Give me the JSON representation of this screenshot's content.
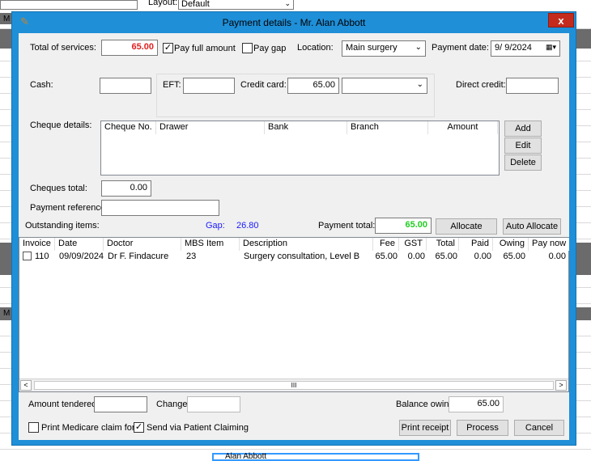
{
  "background": {
    "layout_label": "Layout:",
    "layout_value": "Default",
    "left_letter_top": "M",
    "left_letter_mid": "M",
    "patient_bottom": "Alan Abbott"
  },
  "dialog": {
    "title": "Payment details - Mr. Alan Abbott",
    "close_label": "x"
  },
  "top": {
    "total_services_label": "Total of services:",
    "total_services_value": "65.00",
    "pay_full_label": "Pay full amount",
    "pay_full_checked": true,
    "pay_gap_label": "Pay gap",
    "location_label": "Location:",
    "location_value": "Main surgery",
    "payment_date_label": "Payment date:",
    "payment_date_value": "9/ 9/2024",
    "cash_label": "Cash:",
    "eft_label": "EFT:",
    "credit_card_label": "Credit card:",
    "credit_card_value": "65.00",
    "direct_credit_label": "Direct credit:"
  },
  "cheques": {
    "label": "Cheque details:",
    "columns": [
      "Cheque No.",
      "Drawer",
      "Bank",
      "Branch",
      "Amount"
    ],
    "add_label": "Add",
    "edit_label": "Edit",
    "delete_label": "Delete",
    "total_label": "Cheques total:",
    "total_value": "0.00"
  },
  "payment_reference_label": "Payment reference:",
  "outstanding": {
    "label": "Outstanding items:",
    "gap_label": "Gap:",
    "gap_value": "26.80",
    "payment_total_label": "Payment total:",
    "payment_total_value": "65.00",
    "allocate_label": "Allocate",
    "auto_allocate_label": "Auto Allocate"
  },
  "items_table": {
    "columns": [
      "Invoice",
      "Date",
      "Doctor",
      "MBS Item",
      "Description",
      "Fee",
      "GST",
      "Total",
      "Paid",
      "Owing",
      "Pay now"
    ],
    "rows": [
      {
        "invoice": "110",
        "date": "09/09/2024",
        "doctor": "Dr F. Findacure",
        "mbs": "23",
        "description": "Surgery consultation, Level B",
        "fee": "65.00",
        "gst": "0.00",
        "total": "65.00",
        "paid": "0.00",
        "owing": "65.00",
        "pay_now": "0.00"
      }
    ],
    "scroll_left": "<",
    "scroll_right": ">",
    "scroll_thumb": "III"
  },
  "bottom": {
    "amount_tendered_label": "Amount tendered:",
    "change_label": "Change:",
    "balance_owing_label": "Balance owing:",
    "balance_owing_value": "65.00",
    "print_medicare_label": "Print Medicare claim form",
    "send_patient_claiming_label": "Send via Patient Claiming",
    "send_patient_claiming_checked": true,
    "print_receipt_label": "Print receipt",
    "process_label": "Process",
    "cancel_label": "Cancel"
  },
  "colors": {
    "total_services": "#e02020",
    "gap_value": "#1a1aff",
    "payment_total": "#22cc22",
    "dialog_frame": "#1f8fd8"
  }
}
